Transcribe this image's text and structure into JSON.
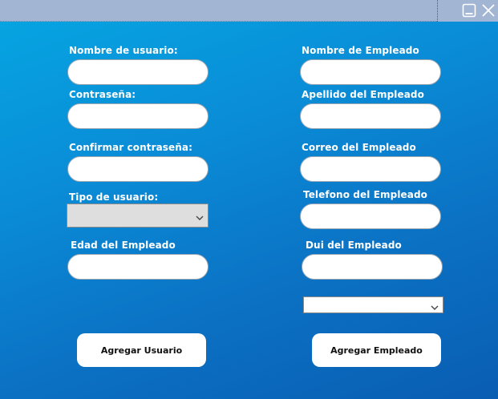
{
  "window": {
    "minimize_icon": "minimize-icon",
    "close_icon": "close-icon"
  },
  "colors": {
    "titlebar": "#a2b6d4",
    "gradient_start": "#06a4e1",
    "gradient_end": "#0a5db2",
    "button_bg": "#ffffff"
  },
  "user_form": {
    "username_label": "Nombre de usuario:",
    "username_value": "",
    "password_label": "Contraseña:",
    "password_value": "",
    "confirm_password_label": "Confirmar contraseña:",
    "confirm_password_value": "",
    "user_type_label": "Tipo de usuario:",
    "user_type_selected": "",
    "age_label": "Edad del Empleado",
    "age_value": "",
    "add_user_button": "Agregar Usuario"
  },
  "employee_form": {
    "first_name_label": "Nombre de Empleado",
    "first_name_value": "",
    "last_name_label": "Apellido del Empleado",
    "last_name_value": "",
    "email_label": "Correo del Empleado",
    "email_value": "",
    "phone_label": "Telefono del Empleado",
    "phone_value": "",
    "dui_label": "Dui del Empleado",
    "dui_value": "",
    "extra_select_selected": "",
    "add_employee_button": "Agregar Empleado"
  }
}
